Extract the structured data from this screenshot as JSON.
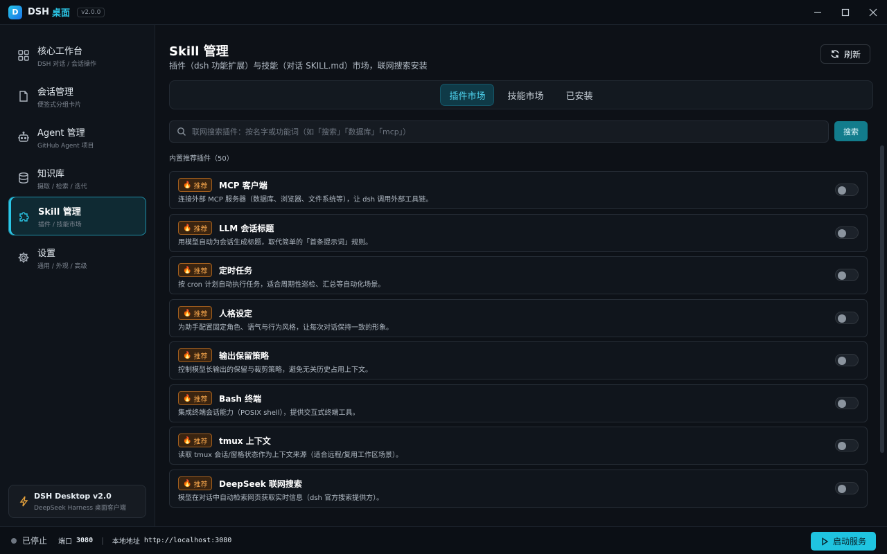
{
  "app": {
    "logo_letter": "D",
    "name": "DSH",
    "name_accent": "桌面",
    "version": "v2.0.0",
    "accent_color": "#2bc6e6"
  },
  "sidebar": {
    "items": [
      {
        "label": "核心工作台",
        "sub": "DSH 对话 / 会话操作",
        "icon": "grid-icon",
        "active": false
      },
      {
        "label": "会话管理",
        "sub": "便签式分组卡片",
        "icon": "document-icon",
        "active": false
      },
      {
        "label": "Agent 管理",
        "sub": "GitHub Agent 项目",
        "icon": "robot-icon",
        "active": false
      },
      {
        "label": "知识库",
        "sub": "摄取 / 检索 / 迭代",
        "icon": "database-icon",
        "active": false
      },
      {
        "label": "Skill 管理",
        "sub": "插件 / 技能市场",
        "icon": "puzzle-icon",
        "active": true
      },
      {
        "label": "设置",
        "sub": "通用 / 外观 / 高级",
        "icon": "gear-icon",
        "active": false
      }
    ],
    "footer_card": {
      "title": "DSH Desktop v2.0",
      "sub": "DeepSeek Harness 桌面客户端",
      "icon": "lightning-icon"
    }
  },
  "main": {
    "title": "Skill 管理",
    "description": "插件（dsh 功能扩展）与技能（对话 SKILL.md）市场，联网搜索安装",
    "refresh_label": "刷新",
    "tabs": [
      {
        "label": "插件市场",
        "active": true
      },
      {
        "label": "技能市场",
        "active": false
      },
      {
        "label": "已安装",
        "active": false
      }
    ],
    "search": {
      "placeholder": "联网搜索插件：按名字或功能词（如「搜索」「数据库」「mcp」）",
      "value": "",
      "button_label": "搜索"
    },
    "section_label": "内置推荐插件（50）",
    "badge_label": "推荐",
    "plugins": [
      {
        "name": "MCP 客户端",
        "desc": "连接外部 MCP 服务器（数据库、浏览器、文件系统等），让 dsh 调用外部工具链。",
        "enabled": false
      },
      {
        "name": "LLM 会话标题",
        "desc": "用模型自动为会话生成标题，取代简单的「首条提示词」规则。",
        "enabled": false
      },
      {
        "name": "定时任务",
        "desc": "按 cron 计划自动执行任务，适合周期性巡检、汇总等自动化场景。",
        "enabled": false
      },
      {
        "name": "人格设定",
        "desc": "为助手配置固定角色、语气与行为风格，让每次对话保持一致的形象。",
        "enabled": false
      },
      {
        "name": "输出保留策略",
        "desc": "控制模型长输出的保留与裁剪策略，避免无关历史占用上下文。",
        "enabled": false
      },
      {
        "name": "Bash 终端",
        "desc": "集成终端会话能力（POSIX shell），提供交互式终端工具。",
        "enabled": false
      },
      {
        "name": "tmux 上下文",
        "desc": "读取 tmux 会话/窗格状态作为上下文来源（适合远程/复用工作区场景）。",
        "enabled": false
      },
      {
        "name": "DeepSeek 联网搜索",
        "desc": "模型在对话中自动检索网页获取实时信息（dsh 官方搜索提供方）。",
        "enabled": false
      }
    ]
  },
  "statusbar": {
    "state": "已停止",
    "port_label": "端口",
    "port": "3080",
    "sep": "|",
    "address_label": "本地地址",
    "address": "http://localhost:3080",
    "start_label": "启动服务"
  }
}
